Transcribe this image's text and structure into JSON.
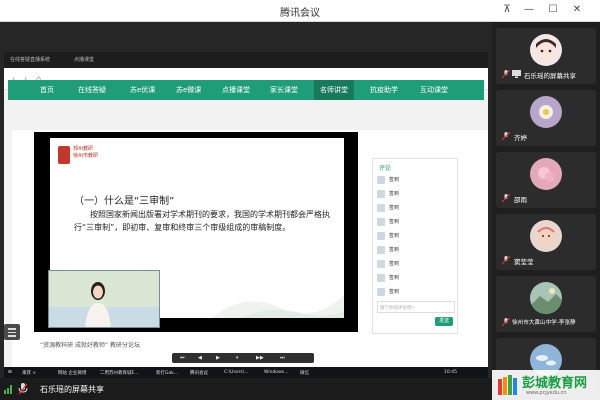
{
  "window": {
    "title": "腾讯会议"
  },
  "browser": {
    "tabs": [
      "在线答疑直播系统",
      "点播课堂"
    ]
  },
  "site_nav": {
    "items": [
      "首页",
      "在线答疑",
      "苏e优课",
      "苏e微课",
      "点播课堂",
      "家长课堂",
      "名师讲堂",
      "抗疫助学",
      "互动课堂"
    ],
    "active_index": 6
  },
  "slide": {
    "logo_text_line1": "邳州教研",
    "logo_text_line2": "徐州市教研",
    "heading": "（一）什么是“三审制”",
    "body": "按照国家新闻出版署对学术期刊的要求，我国的学术期刊都会严格执行“三审制”，即初审、复审和终审三个审级组成的审稿制度。"
  },
  "below_text": "“资源教科研 成就好教师”  教研分论坛",
  "comments": {
    "header": "评论",
    "items": [
      "签到",
      "签到",
      "签到",
      "签到",
      "签到",
      "签到",
      "签到",
      "签到",
      "签到"
    ],
    "input_placeholder": "留下你的评论吧~",
    "send_label": "发送"
  },
  "taskbar": {
    "items": [
      "来宾 ×",
      "网站 企业微博",
      "二用苏州教育城E...",
      "新打Gak...",
      "腾讯会议",
      "C:\\Users\\...",
      "Windows...",
      "微信"
    ],
    "time": "10:45"
  },
  "bottom_bar": {
    "sharing_label": "石乐瑶的屏幕共享"
  },
  "participants": [
    {
      "name": "石乐瑶的屏幕共享",
      "avatar": "cartoon-girl-avatar"
    },
    {
      "name": "齐婷",
      "avatar": "flower-avatar"
    },
    {
      "name": "邵雨",
      "avatar": "pink-flower-avatar"
    },
    {
      "name": "窦莹莹",
      "avatar": "baby-avatar"
    },
    {
      "name": "徐州市大黄山中学-李张静",
      "avatar": "landscape-avatar"
    },
    {
      "name": "",
      "avatar": "sky-avatar"
    }
  ],
  "watermark": {
    "main": "彭城教育网",
    "sub": "www.pcjyedu.cn"
  },
  "colors": {
    "site_green": "#1f9d78",
    "meeting_bg": "#1f1f1f"
  }
}
